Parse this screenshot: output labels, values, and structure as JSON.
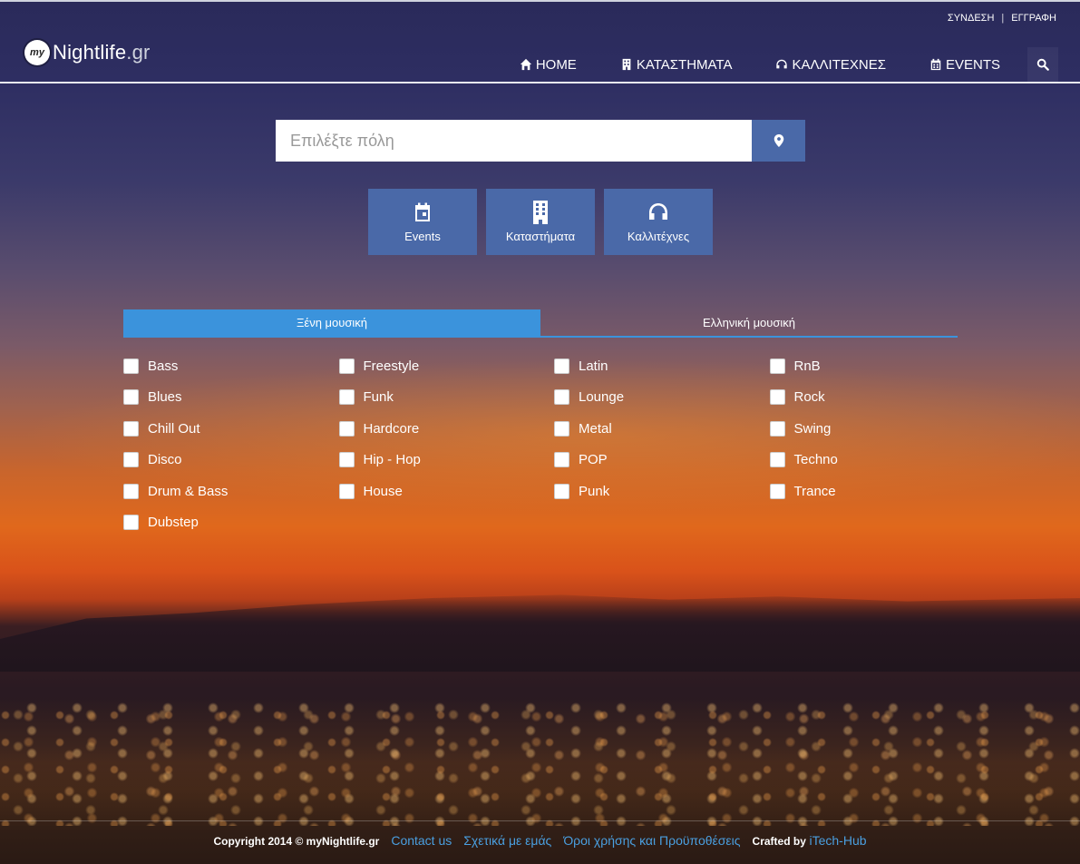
{
  "header": {
    "auth": {
      "login": "ΣΥΝΔΕΣΗ",
      "separator": "|",
      "register": "ΕΓΓΡΑΦΗ"
    },
    "logo": {
      "badge": "my",
      "name": "Nightlife",
      "tld": ".gr"
    },
    "nav": [
      {
        "label": "HOME",
        "icon": "home-icon"
      },
      {
        "label": "ΚΑΤΑΣΤΗΜΑΤΑ",
        "icon": "building-icon"
      },
      {
        "label": "ΚΑΛΛΙΤΕΧΝΕΣ",
        "icon": "headphones-icon"
      },
      {
        "label": "EVENTS",
        "icon": "calendar-icon"
      }
    ]
  },
  "city_search": {
    "placeholder": "Επιλέξτε πόλη",
    "value": ""
  },
  "categories": [
    {
      "label": "Events",
      "icon": "calendar-icon"
    },
    {
      "label": "Καταστήματα",
      "icon": "building-icon"
    },
    {
      "label": "Καλλιτέχνες",
      "icon": "headphones-icon"
    }
  ],
  "tabs": [
    {
      "label": "Ξένη μουσική",
      "active": true
    },
    {
      "label": "Ελληνική μουσική",
      "active": false
    }
  ],
  "genres": [
    [
      "Bass",
      "Blues",
      "Chill Out",
      "Disco",
      "Drum & Bass",
      "Dubstep"
    ],
    [
      "Freestyle",
      "Funk",
      "Hardcore",
      "Hip - Hop",
      "House"
    ],
    [
      "Latin",
      "Lounge",
      "Metal",
      "POP",
      "Punk"
    ],
    [
      "RnB",
      "Rock",
      "Swing",
      "Techno",
      "Trance"
    ]
  ],
  "footer": {
    "copyright": "Copyright 2014 © myNightlife.gr",
    "links": [
      "Contact us",
      "Σχετικά με εμάς",
      "Όροι χρήσης και Προϋποθέσεις"
    ],
    "crafted_by_label": "Crafted by",
    "crafted_by_link": "iTech-Hub"
  },
  "colors": {
    "accent": "#4a69a8",
    "tab_active": "#3b93dc",
    "link": "#4a9fe0"
  }
}
